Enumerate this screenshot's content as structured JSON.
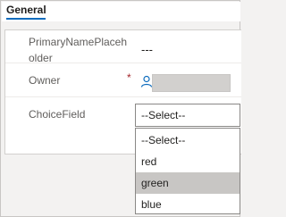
{
  "tab": {
    "label": "General"
  },
  "form": {
    "fields": [
      {
        "label": "PrimaryNamePlaceholder",
        "value": "---"
      },
      {
        "label": "Owner",
        "required_mark": "*"
      },
      {
        "label": "ChoiceField",
        "selected": "--Select--"
      }
    ]
  },
  "dropdown": {
    "options": [
      "--Select--",
      "red",
      "green",
      "blue"
    ],
    "highlighted": "green"
  },
  "colors": {
    "accent": "#0f6cbd",
    "required": "#a4262c",
    "highlight": "#c8c6c4"
  },
  "icons": {
    "owner": "person-icon"
  }
}
